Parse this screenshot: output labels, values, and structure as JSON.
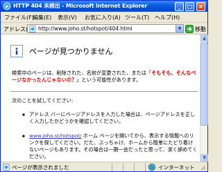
{
  "window": {
    "title": "HTTP 404 未検出 - Microsoft Internet Explorer"
  },
  "menu": [
    "ファイル(F)",
    "編集(E)",
    "表示(V)",
    "お気に入り(A)",
    "ツール(T)",
    "ヘルプ(H)"
  ],
  "address": {
    "label": "アドレス(D)",
    "url": "http://www.joho.st/hotspot/404.html",
    "go_label": "移動"
  },
  "content": {
    "heading": "ページが見つかりません",
    "para_before": "検索中のページは、削除された、名前が変更された、または「",
    "para_highlight": "そもそも、そんなページなかったんじゃないの？",
    "para_after": "」という可能性があります。",
    "try_label": "次のことを試してください:",
    "items": [
      "アドレス バーにページアドレスを入力した場合は、ページアドレスを正しく入力したかどうかを確認してください。",
      "ホーム ページを開いてから、表示する情報へのリンクを探してください。だた、ぶっちゃけ、ホームから簡単にたどり着けないページもあります。その場合は一期一会だったと思って、潔く諦めてください。"
    ],
    "item2_link": "www.joho.st/hotspot/"
  },
  "status": {
    "text": "ページが表示されました",
    "zone": "インターネット"
  },
  "colors": {
    "titlebar": "#0a5fe0",
    "highlight": "#e00000",
    "link": "#3333cc"
  }
}
